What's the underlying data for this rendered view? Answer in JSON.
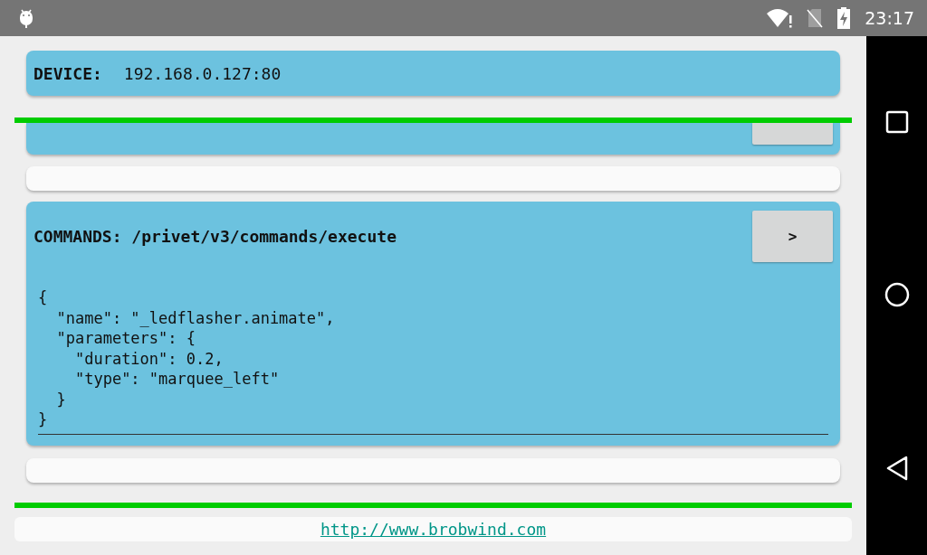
{
  "status_bar": {
    "time": "23:17"
  },
  "device": {
    "label": "DEVICE:",
    "value": "192.168.0.127:80"
  },
  "commands": {
    "label": "COMMANDS:",
    "path": "/privet/v3/commands/execute",
    "button": ">",
    "body": "{\n  \"name\": \"_ledflasher.animate\",\n  \"parameters\": {\n    \"duration\": 0.2,\n    \"type\": \"marquee_left\"\n  }\n}"
  },
  "footer": {
    "link": "http://www.brobwind.com"
  }
}
